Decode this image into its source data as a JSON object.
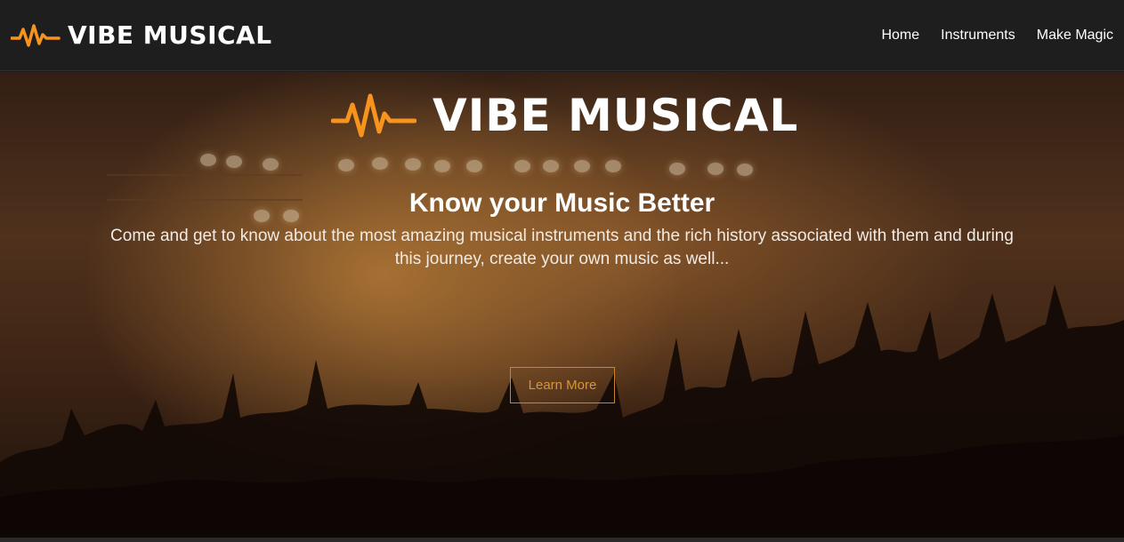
{
  "navbar": {
    "brand_name": "VIBE MUSICAL",
    "brand_icon": "waveform-icon",
    "links": [
      {
        "label": "Home"
      },
      {
        "label": "Instruments"
      },
      {
        "label": "Make Magic"
      }
    ]
  },
  "hero": {
    "logo_text": "VIBE MUSICAL",
    "logo_icon": "waveform-icon",
    "title": "Know your Music Better",
    "subtitle": "Come and get to know about the most amazing musical instruments and the rich history associated with them and during this journey, create your own music as well...",
    "cta_label": "Learn More",
    "background": "concert-crowd-photo"
  },
  "colors": {
    "accent": "#f7941d",
    "navbar_bg": "#1e1e1e",
    "button_border": "#c8862f"
  }
}
